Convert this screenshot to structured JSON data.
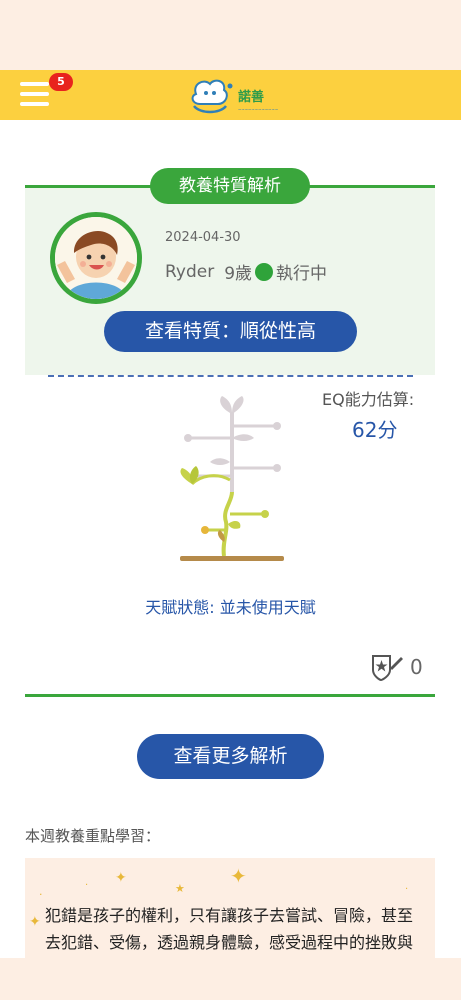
{
  "app": {
    "logo_text": "諾善",
    "notification_count": "5"
  },
  "card": {
    "title": "教養特質解析",
    "date": "2024-04-30",
    "child_name": "Ryder",
    "child_age": "9歲",
    "status": "執行中",
    "trait_button": "查看特質：順從性高"
  },
  "eq": {
    "label": "EQ能力估算:",
    "value": "62分"
  },
  "talent_status": "天賦狀態: 並未使用天賦",
  "achievement_count": "0",
  "more_button": "查看更多解析",
  "weekly": {
    "heading": "本週教養重點學習：",
    "tip": "犯錯是孩子的權利，只有讓孩子去嘗試、冒險，甚至去犯錯、受傷，透過親身體驗，感受過程中的挫敗與勝利，才會學到最多、體會最深。"
  },
  "colors": {
    "header_yellow": "#fcd03f",
    "green": "#3aa63c",
    "blue": "#2756a8",
    "peach": "#fdeee3",
    "badge_red": "#e8231d"
  },
  "icons": [
    "hamburger-menu-icon",
    "logo-icon",
    "avatar",
    "status-dot",
    "growth-tree-icon",
    "achievement-star-icon"
  ]
}
